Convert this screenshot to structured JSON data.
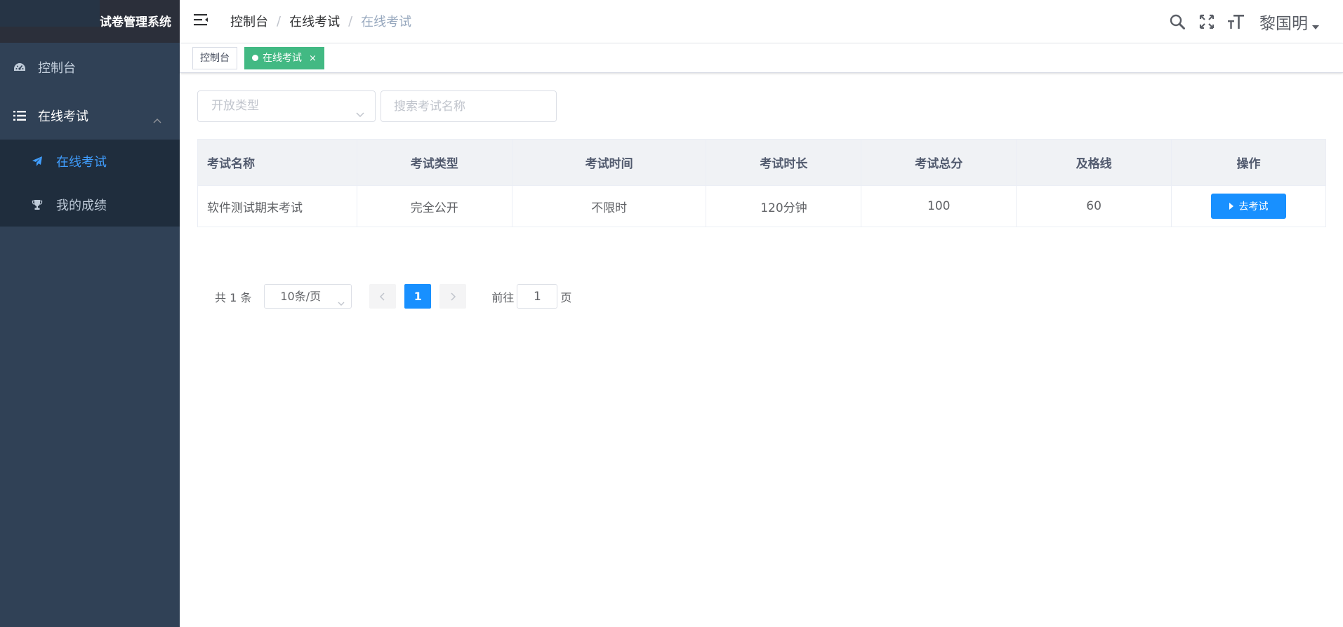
{
  "app": {
    "title": "试卷管理系统"
  },
  "sidebar": {
    "items": [
      {
        "label": "控制台",
        "icon": "dashboard-icon"
      },
      {
        "label": "在线考试",
        "icon": "list-icon",
        "expanded": true,
        "children": [
          {
            "label": "在线考试",
            "icon": "paper-plane-icon",
            "active": true
          },
          {
            "label": "我的成绩",
            "icon": "trophy-icon"
          }
        ]
      }
    ]
  },
  "navbar": {
    "breadcrumb": [
      "控制台",
      "在线考试",
      "在线考试"
    ],
    "separator": "/",
    "user": "黎国明"
  },
  "tags": [
    {
      "label": "控制台",
      "active": false
    },
    {
      "label": "在线考试",
      "active": true,
      "close": "×"
    }
  ],
  "filters": {
    "type_placeholder": "开放类型",
    "search_placeholder": "搜索考试名称"
  },
  "table": {
    "headers": [
      "考试名称",
      "考试类型",
      "考试时间",
      "考试时长",
      "考试总分",
      "及格线",
      "操作"
    ],
    "rows": [
      {
        "name": "软件测试期末考试",
        "type": "完全公开",
        "time": "不限时",
        "duration": "120分钟",
        "total": "100",
        "pass": "60",
        "action": "去考试"
      }
    ]
  },
  "pagination": {
    "total": "共 1 条",
    "page_size": "10条/页",
    "current_page": "1",
    "goto_label": "前往",
    "goto_value": "1",
    "page_suffix": "页"
  },
  "colors": {
    "sidebar_bg": "#304156",
    "submenu_bg": "#1f2d3d",
    "primary": "#1890ff",
    "tag_active": "#42b983",
    "menu_active_text": "#409eff"
  }
}
